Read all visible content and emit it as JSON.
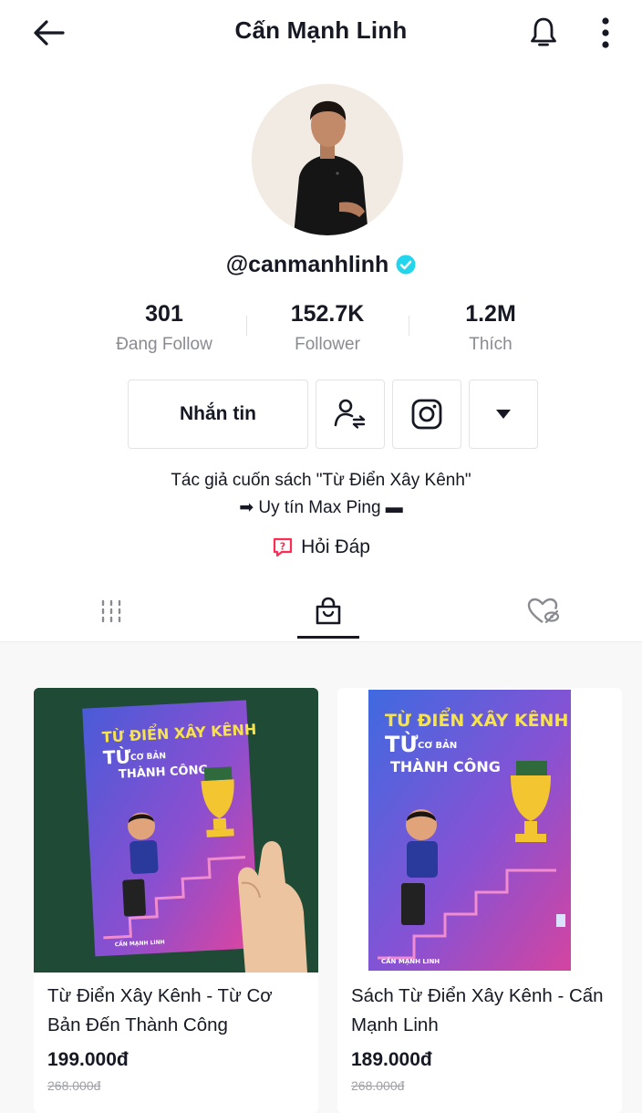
{
  "header": {
    "title": "Cấn Mạnh Linh"
  },
  "profile": {
    "handle": "@canmanhlinh",
    "verified_color": "#20D5EC"
  },
  "stats": [
    {
      "value": "301",
      "label": "Đang Follow"
    },
    {
      "value": "152.7K",
      "label": "Follower"
    },
    {
      "value": "1.2M",
      "label": "Thích"
    }
  ],
  "actions": {
    "message_label": "Nhắn tin"
  },
  "bio": {
    "line1": "Tác giả cuốn sách \"Từ Điển Xây Kênh\"",
    "line2": "➡ Uy tín Max Ping ▬"
  },
  "qa": {
    "label": "Hỏi Đáp",
    "icon_color": "#FE2C55"
  },
  "tabs": {
    "active": "shop"
  },
  "book_cover": {
    "title": "TỪ ĐIỂN XÂY KÊNH",
    "from": "TỪ",
    "subtitle_small": "CƠ BẢN",
    "subtitle_big": "THÀNH CÔNG",
    "author": "CẤN MẠNH LINH"
  },
  "products": [
    {
      "title": "Từ Điển Xây Kênh - Từ Cơ Bản Đến Thành Công",
      "price": "199.000đ",
      "old_price": "268.000đ"
    },
    {
      "title": "Sách Từ Điển Xây Kênh - Cấn Mạnh Linh",
      "price": "189.000đ",
      "old_price": "268.000đ"
    }
  ]
}
